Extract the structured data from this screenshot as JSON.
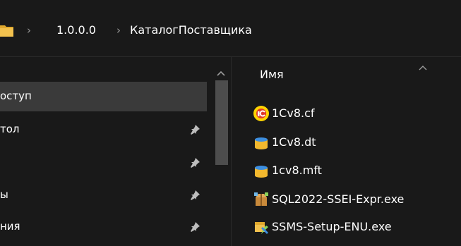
{
  "breadcrumb": {
    "items": [
      "1.0.0.0",
      "КаталогПоставщика"
    ],
    "separator": "›"
  },
  "nav": {
    "items": [
      {
        "label": "оступ",
        "pinned": false,
        "selected": true
      },
      {
        "label": "тол",
        "pinned": true,
        "selected": false
      },
      {
        "label": "",
        "pinned": true,
        "selected": false
      },
      {
        "label": "ы",
        "pinned": true,
        "selected": false
      },
      {
        "label": "ния",
        "pinned": true,
        "selected": false
      }
    ]
  },
  "files": {
    "column_header": "Имя",
    "items": [
      {
        "name": "1Cv8.cf",
        "icon": "onec-logo-icon"
      },
      {
        "name": "1Cv8.dt",
        "icon": "database-icon"
      },
      {
        "name": "1cv8.mft",
        "icon": "database-icon"
      },
      {
        "name": "SQL2022-SSEI-Expr.exe",
        "icon": "installer-package-icon"
      },
      {
        "name": "SSMS-Setup-ENU.exe",
        "icon": "setup-tool-icon"
      }
    ]
  },
  "colors": {
    "background": "#191919",
    "selected": "#3a3a3a",
    "folder": "#f2c14e",
    "onec_red": "#e03a2a",
    "onec_yellow": "#ffd400",
    "db_blue": "#3d8fe0"
  }
}
